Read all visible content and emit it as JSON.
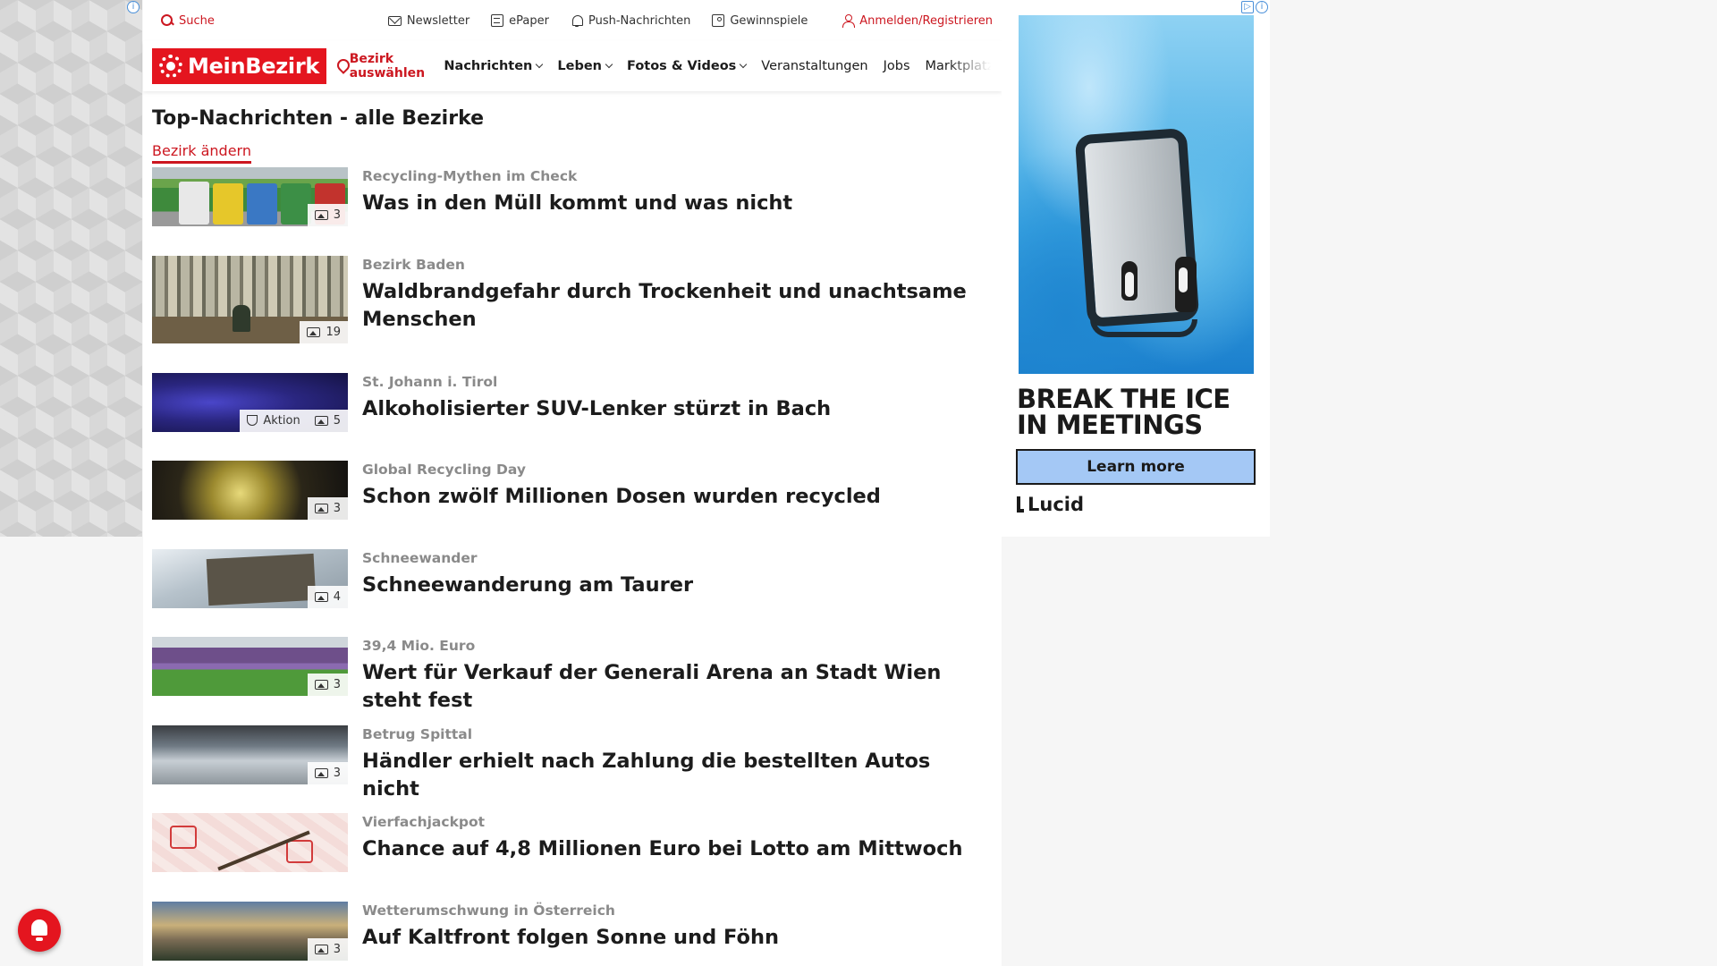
{
  "topbar": {
    "search_label": "Suche",
    "newsletter_label": "Newsletter",
    "epaper_label": "ePaper",
    "push_label": "Push-Nachrichten",
    "contests_label": "Gewinnspiele",
    "login_label": "Anmelden/Registrieren"
  },
  "navbar": {
    "logo_text": "MeinBezirk",
    "location_label": "Bezirk auswählen",
    "items": [
      {
        "label": "Nachrichten"
      },
      {
        "label": "Leben"
      },
      {
        "label": "Fotos & Videos"
      },
      {
        "label": "Veranstaltungen"
      },
      {
        "label": "Jobs"
      },
      {
        "label": "Marktplatz"
      }
    ]
  },
  "main": {
    "title": "Top-Nachrichten - alle Bezirke",
    "change_bezirk_label": "Bezirk ändern",
    "articles": [
      {
        "kicker": "Recycling-Mythen im Check",
        "headline": "Was in den Müll kommt und was nicht",
        "photos": "3"
      },
      {
        "kicker": "Bezirk Baden",
        "headline": "Waldbrandgefahr durch Trockenheit und unachtsame Menschen",
        "photos": "19"
      },
      {
        "kicker": "St. Johann i. Tirol",
        "headline": "Alkoholisierter SUV-Lenker stürzt in Bach",
        "photos": "5",
        "extra_badge": "Aktion"
      },
      {
        "kicker": "Global Recycling Day",
        "headline": "Schon zwölf Millionen Dosen wurden recycled",
        "photos": "3"
      },
      {
        "kicker": "Schneewander",
        "headline": "Schneewanderung am Taurer",
        "photos": "4"
      },
      {
        "kicker": "39,4 Mio. Euro",
        "headline": "Wert für Verkauf der Generali Arena an Stadt Wien steht fest",
        "photos": "3"
      },
      {
        "kicker": "Betrug Spittal",
        "headline": "Händler erhielt nach Zahlung die bestellten Autos nicht",
        "photos": "3"
      },
      {
        "kicker": "Vierfachjackpot",
        "headline": "Chance auf 4,8 Millionen Euro bei Lotto am Mittwoch",
        "photos": null
      },
      {
        "kicker": "Wetterumschwung in Österreich",
        "headline": "Auf Kaltfront folgen Sonne und Föhn",
        "photos": "3"
      }
    ]
  },
  "ad": {
    "headline_line1": "BREAK THE ICE",
    "headline_line2": "IN MEETINGS",
    "cta_label": "Learn more",
    "brand": "Lucid"
  },
  "colors": {
    "brand_red": "#e4151f",
    "accent_red": "#cc1720",
    "kicker_gray": "#8a8a8a",
    "ad_cta_blue": "#a4c8f5"
  },
  "icons": [
    "search-icon",
    "mail-icon",
    "epaper-icon",
    "bell-icon",
    "gift-icon",
    "user-icon",
    "location-pin-icon",
    "chevron-down-icon",
    "image-gallery-icon",
    "trophy-icon",
    "push-bell-icon",
    "adchoices-icon",
    "info-icon"
  ]
}
